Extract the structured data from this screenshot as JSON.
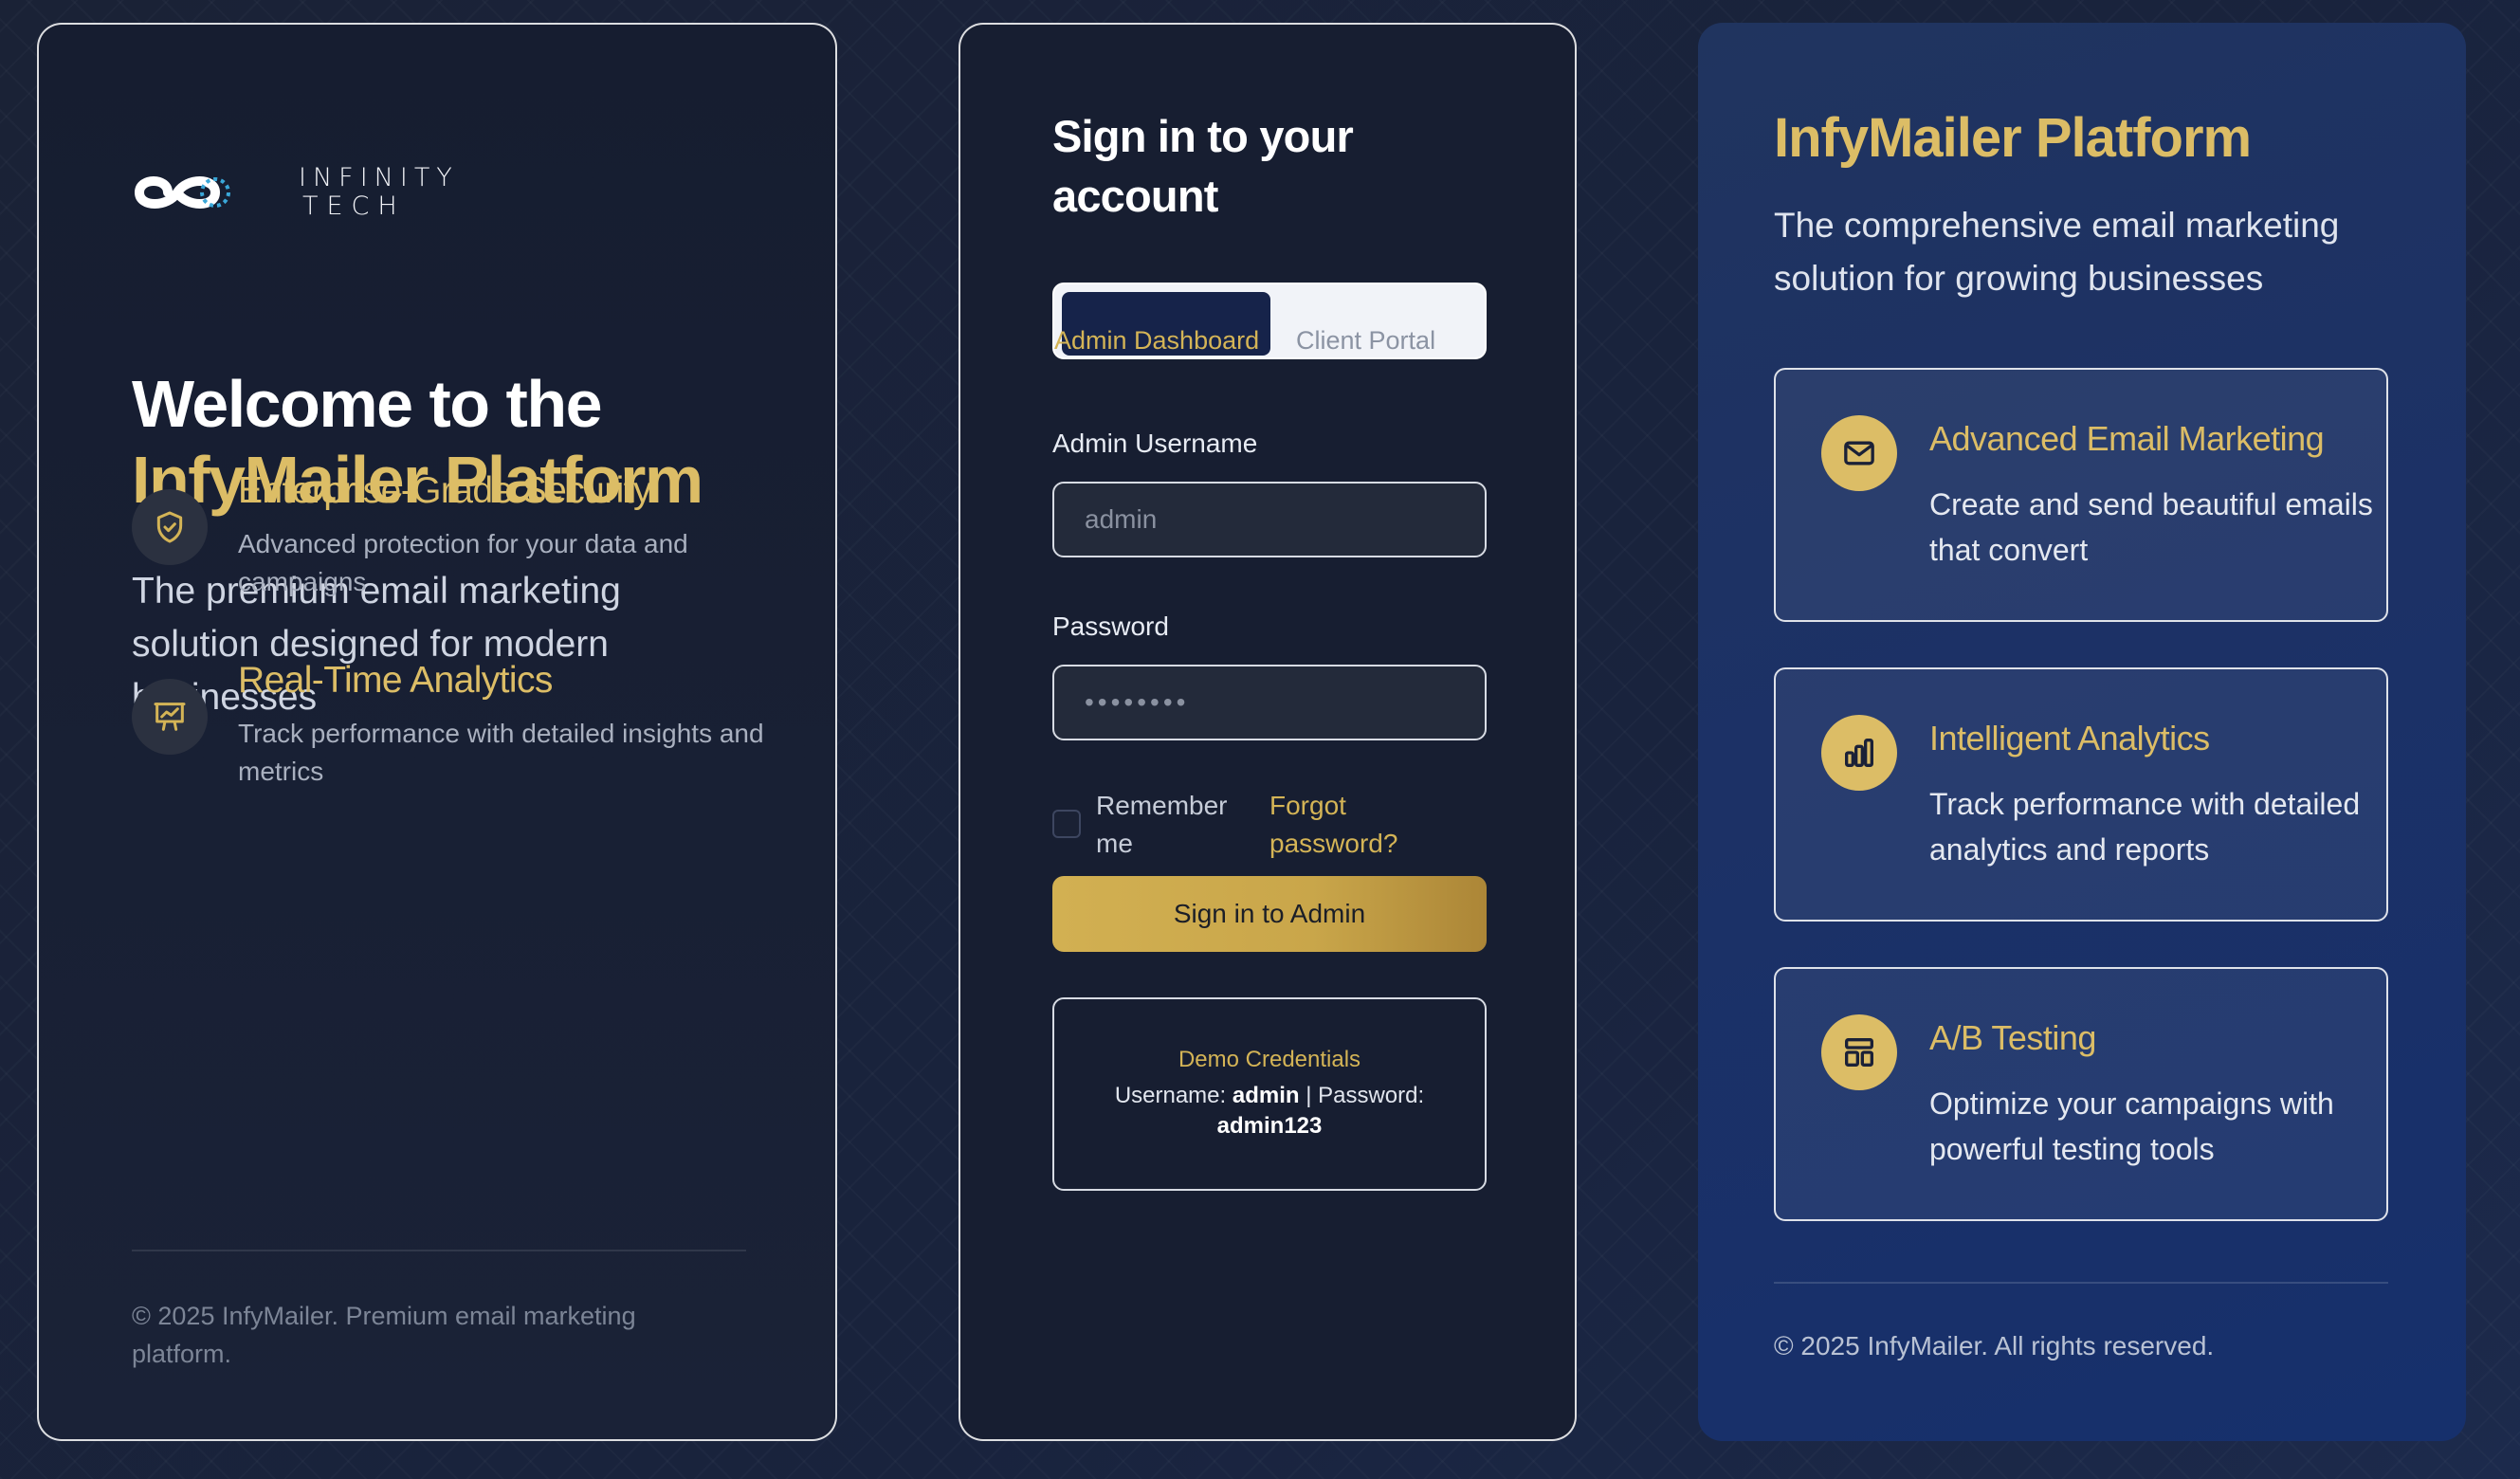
{
  "brand": {
    "logo_line1": "INFINITY",
    "logo_line2": "TECH"
  },
  "left": {
    "welcome_line1": "Welcome to the",
    "welcome_line2": "InfyMailer Platform",
    "lead": "The premium email marketing solution designed for modern businesses",
    "features": [
      {
        "icon": "shield-check-icon",
        "title": "Enterprise-Grade Security",
        "desc": "Advanced protection for your data and campaigns"
      },
      {
        "icon": "presentation-chart-icon",
        "title": "Real-Time Analytics",
        "desc": "Track performance with detailed insights and metrics"
      }
    ],
    "footer": "© 2025 InfyMailer. Premium email marketing platform."
  },
  "login": {
    "title": "Sign in to your account",
    "tabs": [
      {
        "label": "Admin Dashboard",
        "active": true
      },
      {
        "label": "Client Portal",
        "active": false
      }
    ],
    "username_label": "Admin Username",
    "username_placeholder": "admin",
    "password_label": "Password",
    "password_value": "••••••••",
    "remember_label": "Remember me",
    "forgot_label": "Forgot password?",
    "submit_label": "Sign in to Admin",
    "demo": {
      "title": "Demo Credentials",
      "username_prefix": "Username:",
      "username": "admin",
      "separator": "| Password:",
      "password": "admin123"
    }
  },
  "right": {
    "title": "InfyMailer Platform",
    "subtitle": "The comprehensive email marketing solution for growing businesses",
    "cards": [
      {
        "icon": "envelope-icon",
        "title": "Advanced Email Marketing",
        "desc": "Create and send beautiful emails that convert"
      },
      {
        "icon": "bar-chart-icon",
        "title": "Intelligent Analytics",
        "desc": "Track performance with detailed analytics and reports"
      },
      {
        "icon": "layout-icon",
        "title": "A/B Testing",
        "desc": "Optimize your campaigns with powerful testing tools"
      }
    ],
    "footer": "© 2025 InfyMailer. All rights reserved."
  },
  "colors": {
    "gold": "#dcbd66",
    "navy": "#16234a",
    "panel": "#171e31"
  }
}
